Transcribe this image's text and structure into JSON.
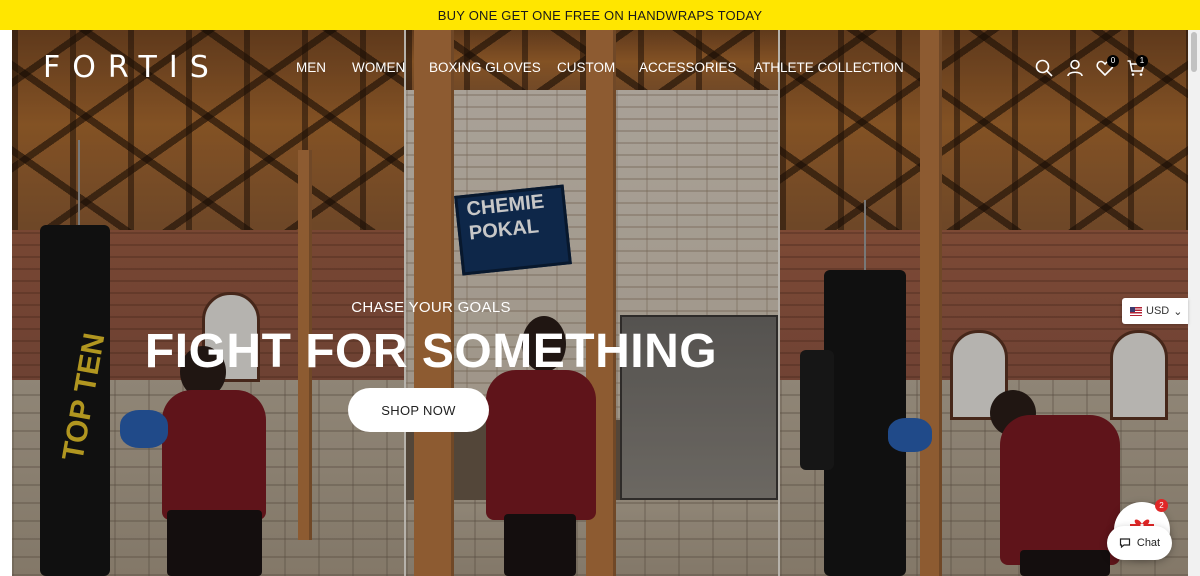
{
  "announcement": {
    "text": "BUY ONE GET ONE FREE ON HANDWRAPS TODAY",
    "background": "#ffe600"
  },
  "header": {
    "logo_text": "FORTIS",
    "nav": [
      {
        "label": "MEN"
      },
      {
        "label": "WOMEN"
      },
      {
        "label": "BOXING GLOVES"
      },
      {
        "label": "CUSTOM"
      },
      {
        "label": "ACCESSORIES"
      },
      {
        "label": "ATHLETE COLLECTION"
      }
    ],
    "icons": {
      "search": "search-icon",
      "account": "user-icon",
      "wishlist": "heart-icon",
      "cart": "cart-icon"
    },
    "wishlist_count": "0",
    "cart_count": "1"
  },
  "hero": {
    "kicker": "CHASE YOUR GOALS",
    "headline": "FIGHT FOR SOMETHING",
    "cta_label": "SHOP NOW",
    "bag_logo": "TOP TEN",
    "sign_lines": [
      "CHEMIE",
      "POKAL"
    ]
  },
  "currency": {
    "code": "USD"
  },
  "widgets": {
    "gift_badge": "2",
    "chat_label": "Chat"
  }
}
